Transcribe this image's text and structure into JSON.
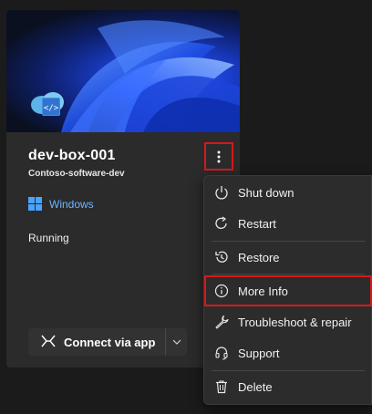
{
  "card": {
    "name": "dev-box-001",
    "project": "Contoso-software-dev",
    "os": "Windows",
    "status": "Running",
    "connect_label": "Connect via app"
  },
  "menu": {
    "items": [
      {
        "label": "Shut down",
        "icon": "power-icon"
      },
      {
        "label": "Restart",
        "icon": "restart-icon"
      },
      {
        "label": "Restore",
        "icon": "restore-icon"
      },
      {
        "label": "More Info",
        "icon": "info-icon",
        "highlighted": true
      },
      {
        "label": "Troubleshoot & repair",
        "icon": "wrench-icon"
      },
      {
        "label": "Support",
        "icon": "headset-icon"
      },
      {
        "label": "Delete",
        "icon": "trash-icon"
      }
    ]
  },
  "colors": {
    "accent": "#4aa3ff",
    "highlight_border": "#d7191c",
    "background": "#1b1b1b",
    "card": "#2b2b2b"
  }
}
